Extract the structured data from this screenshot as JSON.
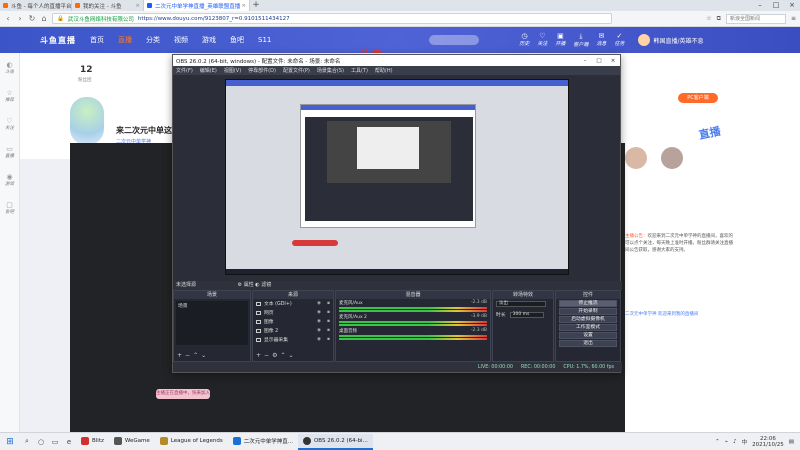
{
  "browser": {
    "tabs": [
      {
        "label": "斗鱼 - 每个人的直播平台",
        "active": false
      },
      {
        "label": "我的关注 - 斗鱼",
        "active": false
      },
      {
        "label": "二次元中单学神直播_英雄联盟直播",
        "active": true
      }
    ],
    "new_tab": "+",
    "secure_label": "武汉斗鱼网络科技有限公司",
    "url": "https://www.douyu.com/9123807_r=0.9101511434127",
    "search_placeholder": "新浪全国新闻"
  },
  "site": {
    "logo": "斗鱼直播",
    "nav": [
      "首页",
      "直播",
      "分类",
      "视频",
      "游戏",
      "鱼吧",
      "S11"
    ],
    "active_nav": 1,
    "header_icons": [
      "历史",
      "关注",
      "开播",
      "客户端",
      "消息",
      "任务"
    ],
    "user_name": "韩国直播/英雄不息",
    "watermark": "斗鱼",
    "left_rail": [
      "斗鱼",
      "推荐",
      "关注",
      "直播",
      "游戏",
      "鱼吧"
    ],
    "fans_count": "12",
    "fans_label": "粉丝团",
    "room_title": "来二次元中单这",
    "anchor_name": "二次元中单学神",
    "right_button": "PC客户端",
    "promo": "直播",
    "announcement_prefix": "主播公告：",
    "announcement": "欢迎来到二次元中单学神的直播间，喜欢的可以点个关注，每天晚上准时开播。粉丝群请关注直播间公告获取，感谢大家的支持。",
    "anchor_link": "二次元中单学神 欢迎来到我的直播间"
  },
  "obs": {
    "title": "OBS 26.0.2 (64-bit, windows) - 配置文件: 未命名 - 场景: 未命名",
    "menu": [
      "文件(F)",
      "编辑(E)",
      "视图(V)",
      "停靠部件(D)",
      "配置文件(P)",
      "场景集合(S)",
      "工具(T)",
      "帮助(H)"
    ],
    "no_source_selected": "未选择源",
    "properties": "属性",
    "filters": "滤镜",
    "docks": {
      "scenes": {
        "title": "场景",
        "items": [
          "场景"
        ]
      },
      "sources": {
        "title": "来源",
        "items": [
          "文本 (GDI+)",
          "网页",
          "图像",
          "图像 2",
          "显示器采集"
        ]
      },
      "mixer": {
        "title": "混音器",
        "channels": [
          {
            "name": "麦克风/Aux",
            "db": "-2.3 dB"
          },
          {
            "name": "麦克风/Aux 2",
            "db": "-3.9 dB"
          },
          {
            "name": "桌面音频",
            "db": "-2.3 dB"
          }
        ]
      },
      "transitions": {
        "title": "转场特效",
        "type": "淡出",
        "duration_label": "时长",
        "duration": "300 ms"
      },
      "controls": {
        "title": "控件",
        "buttons": [
          "停止推流",
          "开始录制",
          "启动虚拟摄像机",
          "工作室模式",
          "设置",
          "退出"
        ]
      }
    },
    "status": {
      "live": "LIVE: 00:00:00",
      "rec": "REC: 00:00:00",
      "cpu": "CPU: 1.7%, 60.00 fps"
    }
  },
  "pink_tag": "主播正在直播中，快来加入",
  "taskbar": {
    "items": [
      {
        "label": "Blitz",
        "color": "#d32f2f"
      },
      {
        "label": "WeGame",
        "color": "#555555"
      },
      {
        "label": "League of Legends",
        "color": "#b58a2a"
      },
      {
        "label": "二次元中单学神直...",
        "color": "#1a6fd8"
      },
      {
        "label": "OBS 26.0.2 (64-bi...",
        "color": "#333333"
      }
    ],
    "active_index": 4,
    "time": "22:06",
    "date": "2021/10/25",
    "input_method": "中"
  }
}
